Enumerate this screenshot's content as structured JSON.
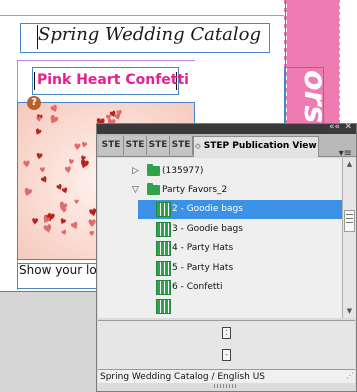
{
  "document": {
    "title": "Spring Wedding Catalog",
    "subtitle": "Pink Heart Confetti",
    "caption": "Show your lo",
    "banner_text": "ors",
    "image_badge": "?"
  },
  "panel": {
    "tabs": [
      {
        "label": "STE"
      },
      {
        "label": "STE"
      },
      {
        "label": "STE"
      },
      {
        "label": "STE"
      },
      {
        "label": "STEP Publication View",
        "active": true
      }
    ],
    "active_tab_icon": "chevron-updown-icon",
    "menu_icon": "panel-menu-icon",
    "collapse_label": "««",
    "close_label": "✕",
    "tree": [
      {
        "label": "(135977)",
        "type": "folder",
        "expanded": false,
        "level": 1
      },
      {
        "label": "Party Favors_2",
        "type": "folder",
        "expanded": true,
        "level": 1
      },
      {
        "label": "2 - Goodie bags",
        "type": "table",
        "level": 2,
        "selected": true
      },
      {
        "label": "3 - Goodie bags",
        "type": "table",
        "level": 2
      },
      {
        "label": "4 - Party Hats",
        "type": "table",
        "level": 2
      },
      {
        "label": "5 - Party Hats",
        "type": "table",
        "level": 2
      },
      {
        "label": "6 - Confetti",
        "type": "table",
        "level": 2
      }
    ],
    "status": "Spring Wedding Catalog / English US"
  },
  "colors": {
    "selection": "#3b91e6",
    "folder_green": "#2fa24a",
    "banner_pink": "#ee7bb2",
    "subtitle_pink": "#e6208c",
    "frame_blue": "#4a86c8"
  }
}
